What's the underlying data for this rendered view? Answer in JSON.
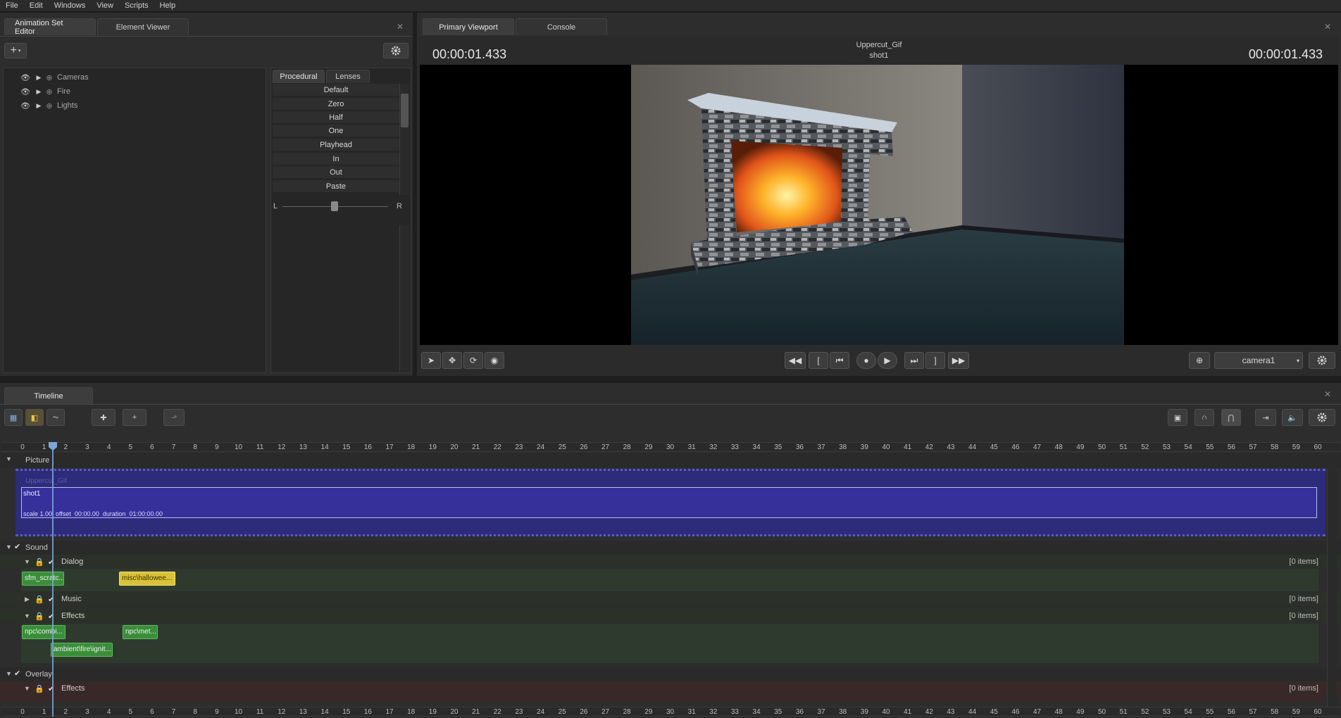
{
  "menu": [
    "File",
    "Edit",
    "Windows",
    "View",
    "Scripts",
    "Help"
  ],
  "left_panel": {
    "tabs": [
      "Animation Set Editor",
      "Element Viewer"
    ],
    "tree": [
      "Cameras",
      "Fire",
      "Lights"
    ],
    "proc_tabs": [
      "Procedural",
      "Lenses"
    ],
    "proc_buttons": [
      "Default",
      "Zero",
      "Half",
      "One",
      "Playhead",
      "In",
      "Out",
      "Paste"
    ],
    "slider_left": "L",
    "slider_right": "R"
  },
  "viewport": {
    "tabs": [
      "Primary Viewport",
      "Console"
    ],
    "time_left": "00:00:01.433",
    "time_right": "00:00:01.433",
    "session_name": "Uppercut_Gif",
    "shot_name": "shot1",
    "camera": "camera1"
  },
  "timeline": {
    "tab": "Timeline",
    "ruler_ticks": [
      "0",
      "1",
      "2",
      "3",
      "4",
      "5",
      "6",
      "7",
      "8",
      "9",
      "10",
      "11",
      "12",
      "13",
      "14",
      "15",
      "16",
      "17",
      "18",
      "19",
      "20",
      "21",
      "22",
      "23",
      "24",
      "25",
      "26",
      "27",
      "28",
      "29",
      "30",
      "31",
      "32",
      "33",
      "34",
      "35",
      "36",
      "37",
      "38",
      "39",
      "40",
      "41",
      "42",
      "43",
      "44",
      "45",
      "46",
      "47",
      "48",
      "49",
      "50",
      "51",
      "52",
      "53",
      "54",
      "55",
      "56",
      "57",
      "58",
      "59",
      "60"
    ],
    "picture_label": "Picture",
    "session_ghost": "Uppercut_Gif",
    "shot": {
      "name": "shot1",
      "info": "scale 1.00  offset  00:00.00  duration  01:00:00.00"
    },
    "sound_label": "Sound",
    "dialog_label": "Dialog",
    "music_label": "Music",
    "effects_label": "Effects",
    "overlay_label": "Overlay",
    "overlay_effects_label": "Effects",
    "items_text": "[0 items]",
    "clips": {
      "dialog_1": "sfm_scratc...",
      "dialog_2": "misc\\hallowee...",
      "effects_1": "npc\\combi...",
      "effects_2": "npc\\met...",
      "effects_3": "ambient\\fire\\ignit..."
    }
  },
  "colors": {
    "shot_bg": "#35309a",
    "picture_track": "#2c2c7a",
    "sound_track": "#2f3a2e",
    "overlay_track": "#3a2828",
    "clip_green": "#3a8e3a",
    "clip_yellow": "#d9c236"
  }
}
